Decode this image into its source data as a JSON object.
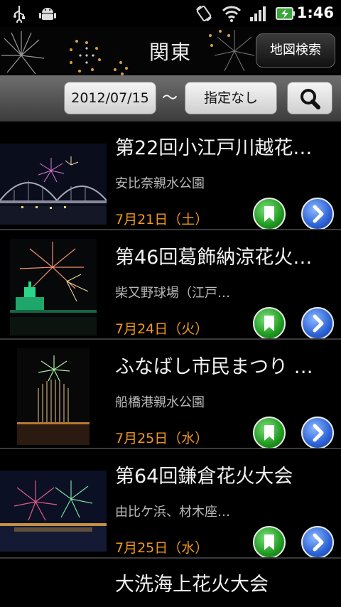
{
  "status_bar": {
    "time": "1:46",
    "icons": [
      "usb-icon",
      "android-debug-icon",
      "screen-rotate-icon",
      "wifi-icon",
      "signal-icon",
      "battery-charging-icon"
    ]
  },
  "header": {
    "title": "関東",
    "map_search_label": "地図検索"
  },
  "filter": {
    "start_date": "2012/07/15",
    "separator": "～",
    "end_date": "指定なし",
    "search_icon": "search-icon"
  },
  "colors": {
    "date_text": "#f59a1c",
    "bookmark_button": "#1f9a1f",
    "detail_button": "#2b62d6"
  },
  "events": [
    {
      "title": "第22回小江戸川越花…",
      "place": "安比奈親水公園",
      "date": "7月21日（土）"
    },
    {
      "title": "第46回葛飾納涼花火…",
      "place": "柴又野球場（江戸…",
      "date": "7月24日（火）"
    },
    {
      "title": "ふなばし市民まつり …",
      "place": "船橋港親水公園",
      "date": "7月25日（水）"
    },
    {
      "title": "第64回鎌倉花火大会",
      "place": "由比ケ浜、材木座…",
      "date": "7月25日（水）"
    },
    {
      "title": "大洗海上花火大会",
      "place": "",
      "date": ""
    }
  ]
}
